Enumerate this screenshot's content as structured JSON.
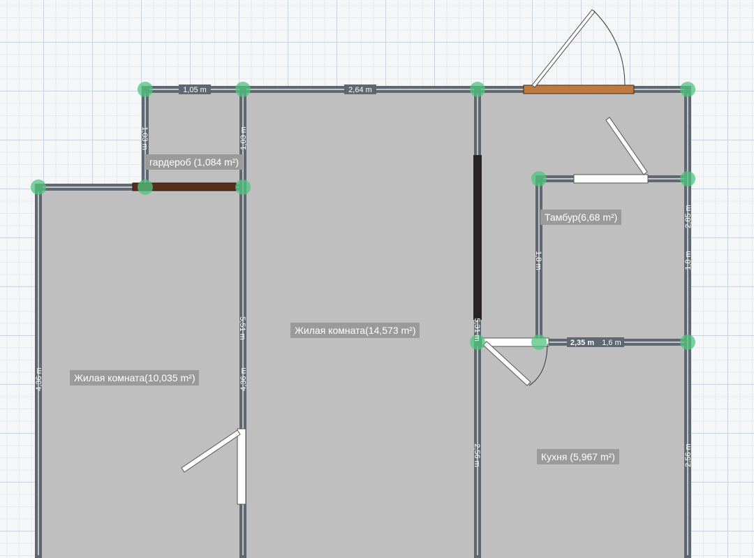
{
  "rooms": {
    "wardrobe": "гардероб (1,084 m²)",
    "living_right": "Жилая комната(14,573 m²)",
    "living_left": "Жилая комната(10,035 m²)",
    "vestibule": "Тамбур(6,68 m²)",
    "kitchen": "Кухня (5,967 m²)"
  },
  "dimensions": {
    "top_left": "1,05 m",
    "top_middle": "2,64 m",
    "wardrobe_left": "1,03 m",
    "wardrobe_right": "1,03 m",
    "inner_wall_upper": "5,51 m",
    "left_outer": "4,36 m",
    "inner_wall_lower": "4,36 m",
    "partition_short": "5,31 m",
    "vestibule_left": "1,8 m",
    "vestibule_right": "1,8 m",
    "right_upper": "2,85 m",
    "vestibule_bottom": "2,35 m",
    "vestibule_bottom_inner": "1,6 m",
    "kitchen_left": "2,56 m",
    "kitchen_right": "2,56 m"
  },
  "colors": {
    "wall": "#5f6770",
    "floor": "#bfbfbf",
    "wood_door": "#c07a3e",
    "dark_door": "#5a2c1c",
    "node": "#4fc47f"
  }
}
